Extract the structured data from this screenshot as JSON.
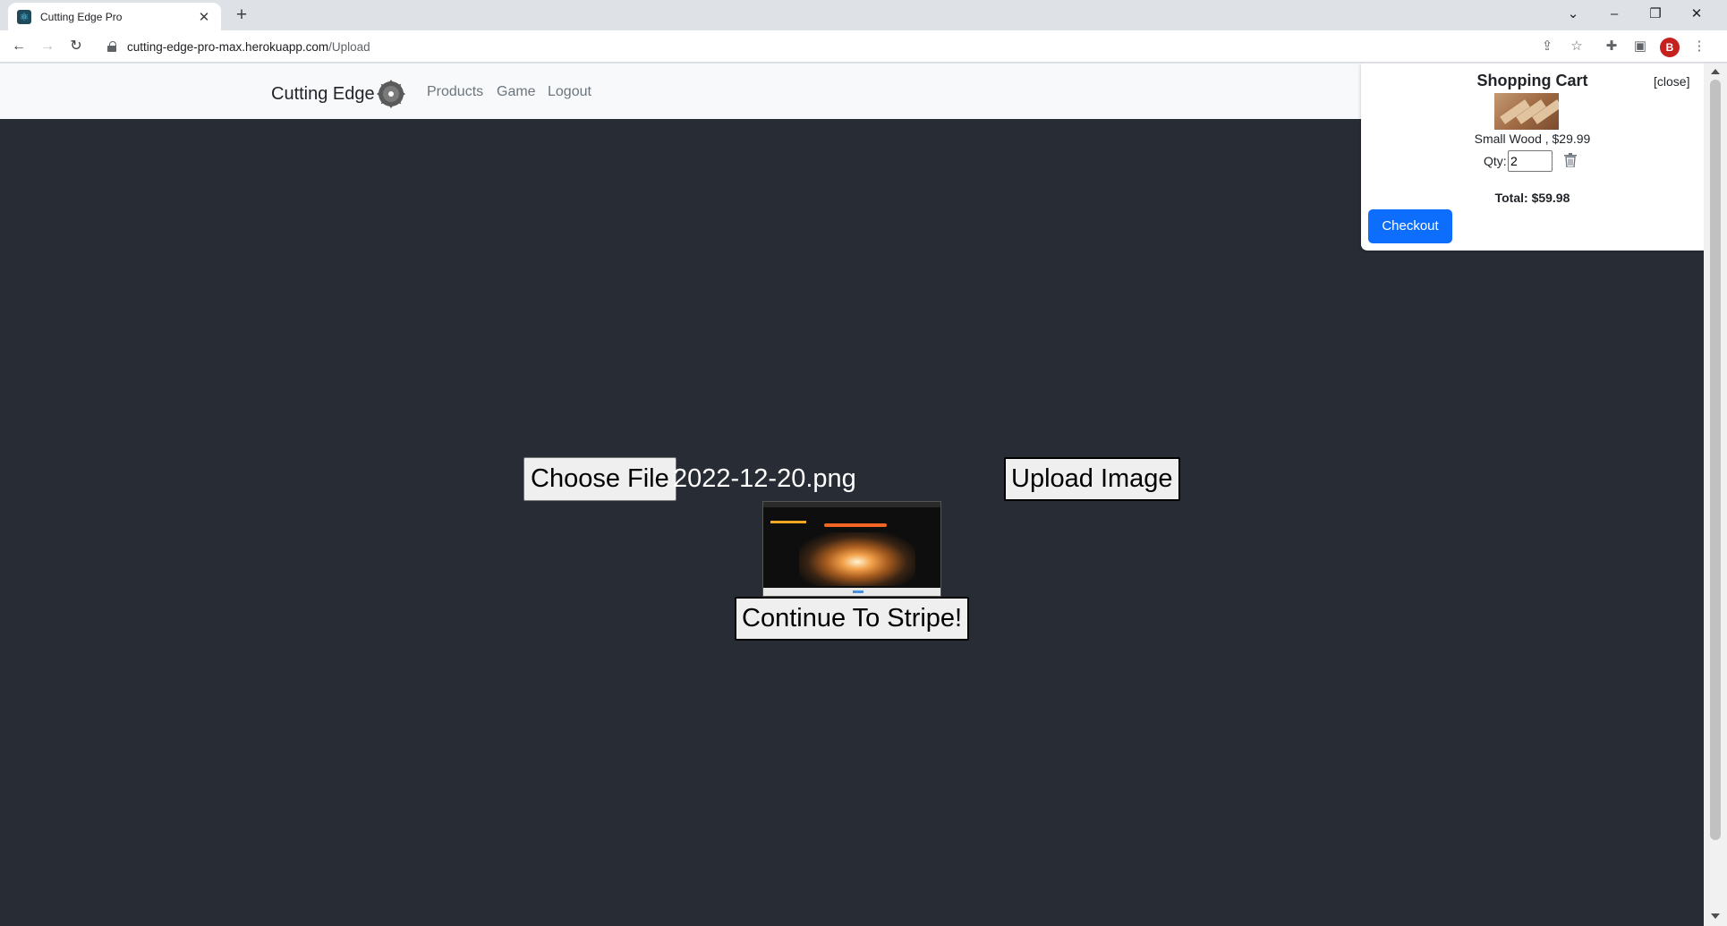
{
  "browser": {
    "tab_title": "Cutting Edge Pro",
    "url_host": "cutting-edge-pro-max.herokuapp.com",
    "url_path": "/Upload",
    "profile_initial": "B"
  },
  "navbar": {
    "brand": "Cutting Edge",
    "links": [
      "Products",
      "Game",
      "Logout"
    ]
  },
  "upload": {
    "choose_file_label": "Choose File",
    "file_name": "2022-12-20.png",
    "upload_button_label": "Upload Image",
    "continue_button_label": "Continue To Stripe!"
  },
  "cart": {
    "title": "Shopping Cart",
    "close_label": "[close]",
    "item_line": "Small Wood , $29.99",
    "qty_label": "Qty:",
    "qty_value": "2",
    "total": "Total: $59.98",
    "checkout_label": "Checkout"
  },
  "colors": {
    "page_background": "#282c34",
    "navbar_background": "#f8f9fa",
    "checkout_blue": "#0d6efd"
  }
}
